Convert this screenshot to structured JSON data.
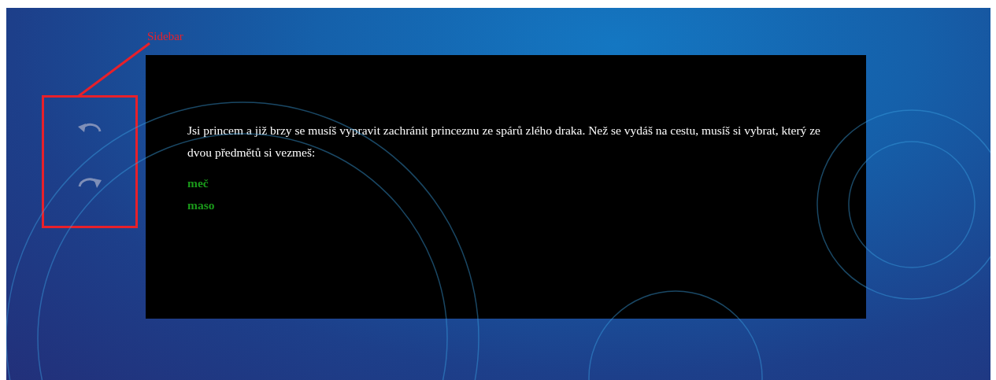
{
  "annotation": {
    "label": "Sidebar"
  },
  "story": {
    "text": "Jsi princem a již brzy se musíš vypravit zachránit princeznu ze spárů zlého draka. Než se vydáš na cestu, musíš si vybrat, který ze dvou předmětů si vezmeš:",
    "choices": [
      "meč",
      "maso"
    ]
  }
}
